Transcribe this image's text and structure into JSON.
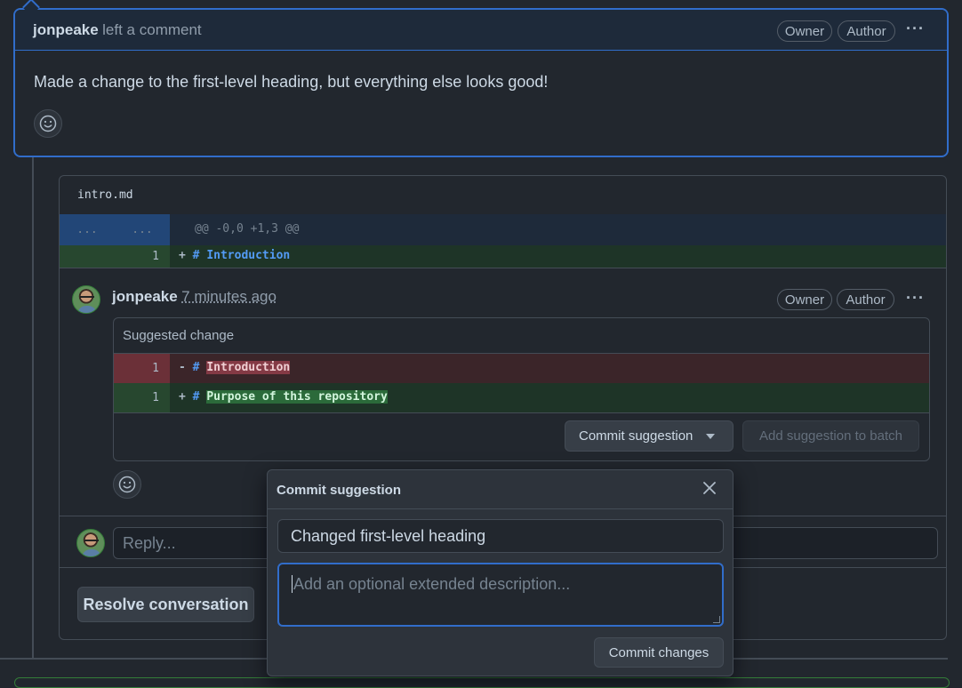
{
  "top_comment": {
    "author": "jonpeake",
    "action": "left a comment",
    "badges": [
      "Owner",
      "Author"
    ],
    "menu_icon": "kebab-horizontal-icon",
    "body": "Made a change to the first-level heading, but everything else looks good!",
    "reaction_icon": "smiley-icon"
  },
  "thread": {
    "file_name": "intro.md",
    "hunk": {
      "left_num": "...",
      "right_num": "...",
      "header": "@@ -0,0 +1,3 @@"
    },
    "added_line": {
      "num": "1",
      "sign": "+",
      "marker": "#",
      "text": "Introduction"
    },
    "review_comment": {
      "author": "jonpeake",
      "time": "7 minutes ago",
      "badges": [
        "Owner",
        "Author"
      ],
      "suggestion": {
        "header": "Suggested change",
        "removed": {
          "num": "1",
          "sign": "-",
          "marker": "#",
          "text": "Introduction"
        },
        "added": {
          "num": "1",
          "sign": "+",
          "marker": "#",
          "text": "Purpose of this repository"
        },
        "commit_button": "Commit suggestion",
        "batch_button": "Add suggestion to batch"
      }
    },
    "reply_placeholder": "Reply...",
    "resolve_button": "Resolve conversation"
  },
  "popover": {
    "title": "Commit suggestion",
    "close_icon": "x-icon",
    "message_value": "Changed first-level heading",
    "description_placeholder": "Add an optional extended description...",
    "commit_button": "Commit changes"
  },
  "colors": {
    "background": "#22272e",
    "accent_blue": "#316dca",
    "addition_green": "#27472f",
    "deletion_red": "#6b3038"
  }
}
